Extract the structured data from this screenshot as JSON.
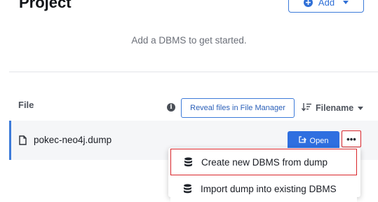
{
  "header": {
    "title": "Project",
    "add_label": "Add"
  },
  "empty_state": {
    "message": "Add a DBMS to get started."
  },
  "files": {
    "header": "File",
    "reveal_label": "Reveal files in File Manager",
    "sort_label": "Filename",
    "rows": [
      {
        "name": "pokec-neo4j.dump",
        "open_label": "Open",
        "more_label": "•••"
      }
    ]
  },
  "context_menu": {
    "items": [
      {
        "label": "Create new DBMS from dump"
      },
      {
        "label": "Import dump into existing DBMS"
      }
    ]
  },
  "colors": {
    "accent": "#2f6fe0",
    "highlight": "#d9252a"
  },
  "icons": {
    "add": "plus-circle-icon",
    "info": "info-icon",
    "sort": "sort-descending-icon",
    "file": "file-icon",
    "open": "open-external-icon",
    "more": "ellipsis-icon",
    "menu_item": "database-icon"
  }
}
